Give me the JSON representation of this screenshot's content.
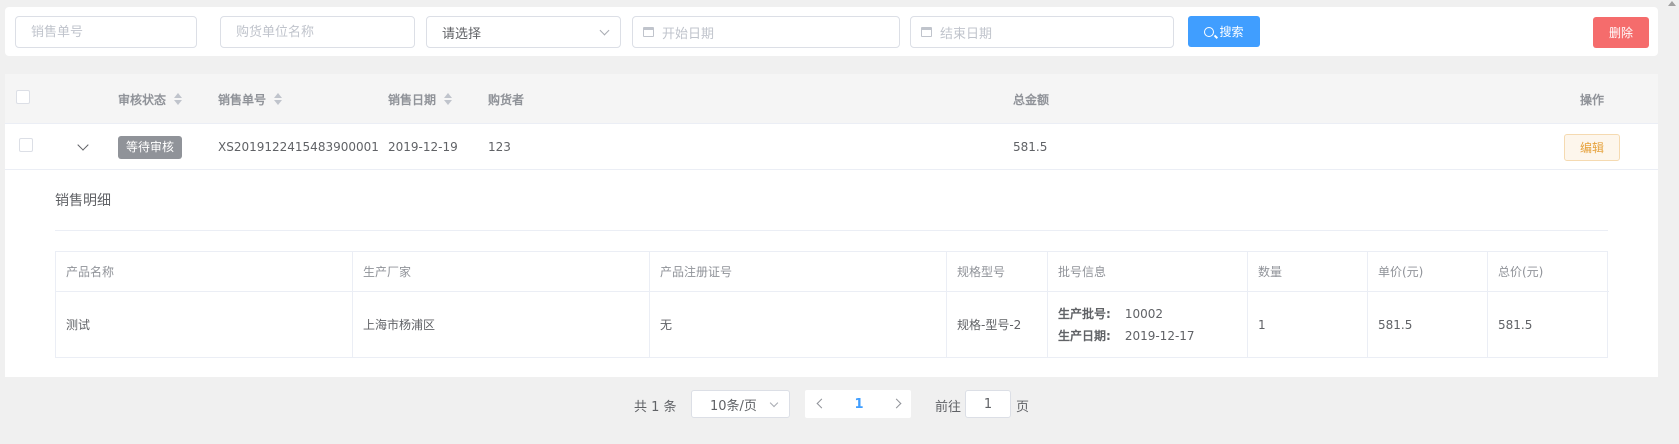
{
  "search": {
    "order_no_placeholder": "销售单号",
    "buyer_name_placeholder": "购货单位名称",
    "status_select": "请选择",
    "start_date_placeholder": "开始日期",
    "end_date_placeholder": "结束日期",
    "search_label": "搜索",
    "delete_label": "删除"
  },
  "table": {
    "headers": {
      "status": "审核状态",
      "order_no": "销售单号",
      "sale_date": "销售日期",
      "buyer": "购货者",
      "total": "总金额",
      "actions": "操作"
    },
    "rows": [
      {
        "status_tag": "等待审核",
        "order_no": "XS2019122415483900001",
        "sale_date": "2019-12-19",
        "buyer": "123",
        "total": "581.5",
        "edit_label": "编辑"
      }
    ]
  },
  "detail": {
    "title": "销售明细",
    "headers": [
      "产品名称",
      "生产厂家",
      "产品注册证号",
      "规格型号",
      "批号信息",
      "数量",
      "单价(元)",
      "总价(元)"
    ],
    "rows": [
      {
        "product_name": "测试",
        "manufacturer": "上海市杨浦区",
        "registration_no": "无",
        "spec": "规格-型号-2",
        "batch_label": "生产批号:",
        "batch_value": "10002",
        "prod_date_label": "生产日期:",
        "prod_date_value": "2019-12-17",
        "quantity": "1",
        "unit_price": "581.5",
        "total_price": "581.5"
      }
    ]
  },
  "pagination": {
    "total": "共 1 条",
    "page_size": "10条/页",
    "current_page": "1",
    "goto_label": "前往",
    "goto_value": "1",
    "page_suffix": "页"
  },
  "colors": {
    "primary": "#409eff",
    "danger": "#f56c6c",
    "warning": "#e6a23c",
    "info": "#909399"
  }
}
